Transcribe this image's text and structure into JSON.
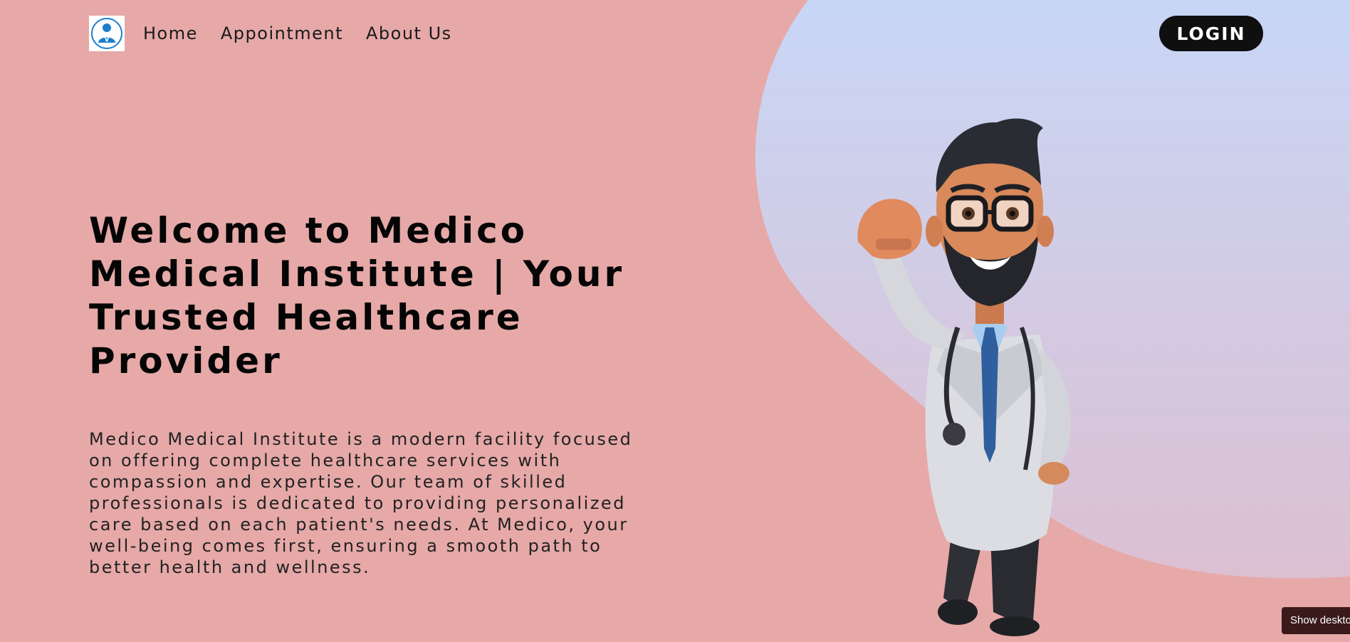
{
  "colors": {
    "page_background": "#e6a9a8",
    "blob_top": "#c8d6f6",
    "blob_bottom": "#dcc0d2",
    "button_background": "#0f0f10",
    "toast_background": "#3a1a1a"
  },
  "header": {
    "logo_icon": "doctor-logo-icon",
    "nav": [
      {
        "label": "Home"
      },
      {
        "label": "Appointment"
      },
      {
        "label": "About Us"
      }
    ],
    "login_label": "LOGIN"
  },
  "hero": {
    "title": "Welcome to Medico Medical Institute | Your Trusted Healthcare Provider",
    "description": "Medico Medical Institute is a modern facility focused on offering complete healthcare services with compassion and expertise. Our team of skilled professionals is dedicated to providing personalized care based on each patient's needs. At Medico, your well-being comes first, ensuring a smooth path to better health and wellness."
  },
  "illustration": {
    "icon": "cartoon-doctor-illustration"
  },
  "toast": {
    "label": "Show desktop"
  }
}
